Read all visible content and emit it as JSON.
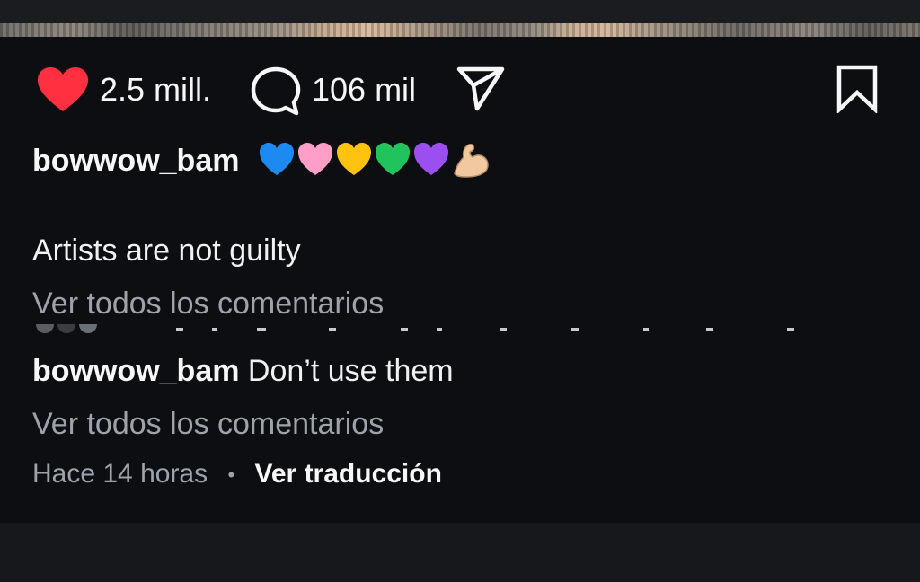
{
  "post": {
    "likes_count": "2.5 mill.",
    "comments_count": "106 mil",
    "caption_username": "bowwow_bam",
    "caption_emojis": [
      "blue-heart",
      "pink-heart",
      "yellow-heart",
      "green-heart",
      "purple-heart",
      "flexed-biceps"
    ],
    "caption_text": "Artists are not guilty",
    "view_all_comments_1": "Ver todos los comentarios",
    "comment_username": "bowwow_bam",
    "comment_text": "Don’t use them",
    "view_all_comments_2": "Ver todos los comentarios",
    "time_ago": "Hace 14 horas",
    "separator": "•",
    "translate_label": "Ver traducción"
  },
  "icons": {
    "like": "heart-icon",
    "comment": "comment-bubble-icon",
    "share": "paper-plane-icon",
    "save": "bookmark-icon"
  },
  "colors": {
    "background": "#0c0e12",
    "like_red": "#ff3040",
    "text_primary": "#f7f7f7",
    "text_muted": "#9ea3ab"
  }
}
